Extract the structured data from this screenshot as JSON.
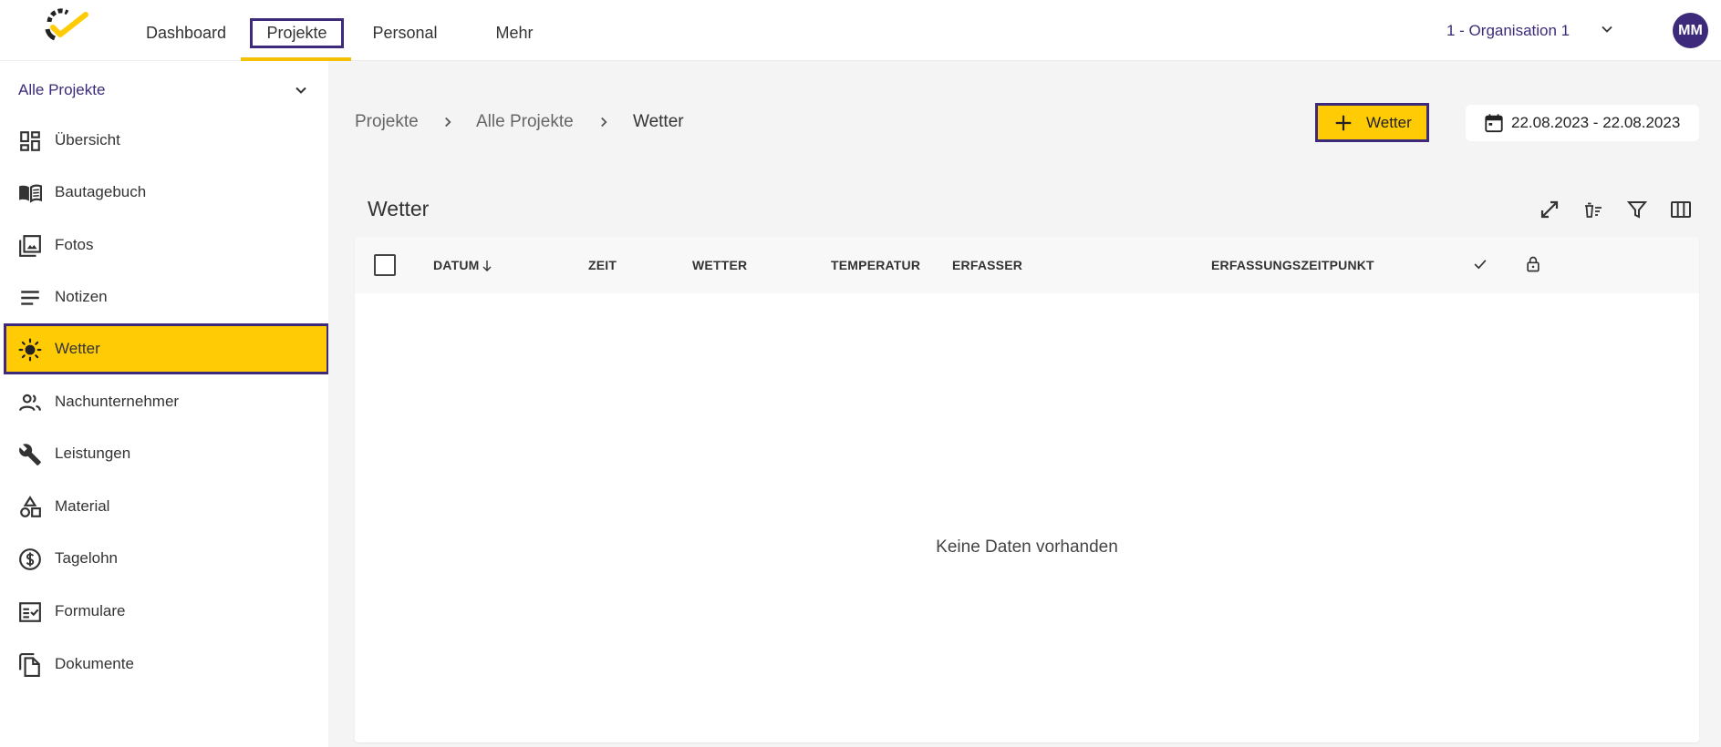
{
  "header": {
    "nav": [
      {
        "label": "Dashboard"
      },
      {
        "label": "Projekte"
      },
      {
        "label": "Personal"
      },
      {
        "label": "Mehr"
      }
    ],
    "organisation": "1 - Organisation 1",
    "avatar_initials": "MM"
  },
  "sidebar": {
    "project_select": "Alle Projekte",
    "items": [
      {
        "label": "Übersicht",
        "icon": "dashboard-icon"
      },
      {
        "label": "Bautagebuch",
        "icon": "book-icon"
      },
      {
        "label": "Fotos",
        "icon": "photos-icon"
      },
      {
        "label": "Notizen",
        "icon": "notes-icon"
      },
      {
        "label": "Wetter",
        "icon": "sun-icon",
        "active": true
      },
      {
        "label": "Nachunternehmer",
        "icon": "people-icon"
      },
      {
        "label": "Leistungen",
        "icon": "wrench-icon"
      },
      {
        "label": "Material",
        "icon": "shapes-icon"
      },
      {
        "label": "Tagelohn",
        "icon": "dollar-icon"
      },
      {
        "label": "Formulare",
        "icon": "checklist-icon"
      },
      {
        "label": "Dokumente",
        "icon": "documents-icon"
      }
    ]
  },
  "breadcrumb": [
    "Projekte",
    "Alle Projekte",
    "Wetter"
  ],
  "toolbar": {
    "add_label": "Wetter",
    "date_range": "22.08.2023 - 22.08.2023"
  },
  "table": {
    "title": "Wetter",
    "columns": [
      "DATUM",
      "ZEIT",
      "WETTER",
      "TEMPERATUR",
      "ERFASSER",
      "ERFASSUNGSZEITPUNKT"
    ],
    "empty_text": "Keine Daten vorhanden"
  },
  "colors": {
    "accent_yellow": "#ffcb05",
    "brand_purple": "#3d2a7a",
    "background": "#f4f4f4"
  }
}
